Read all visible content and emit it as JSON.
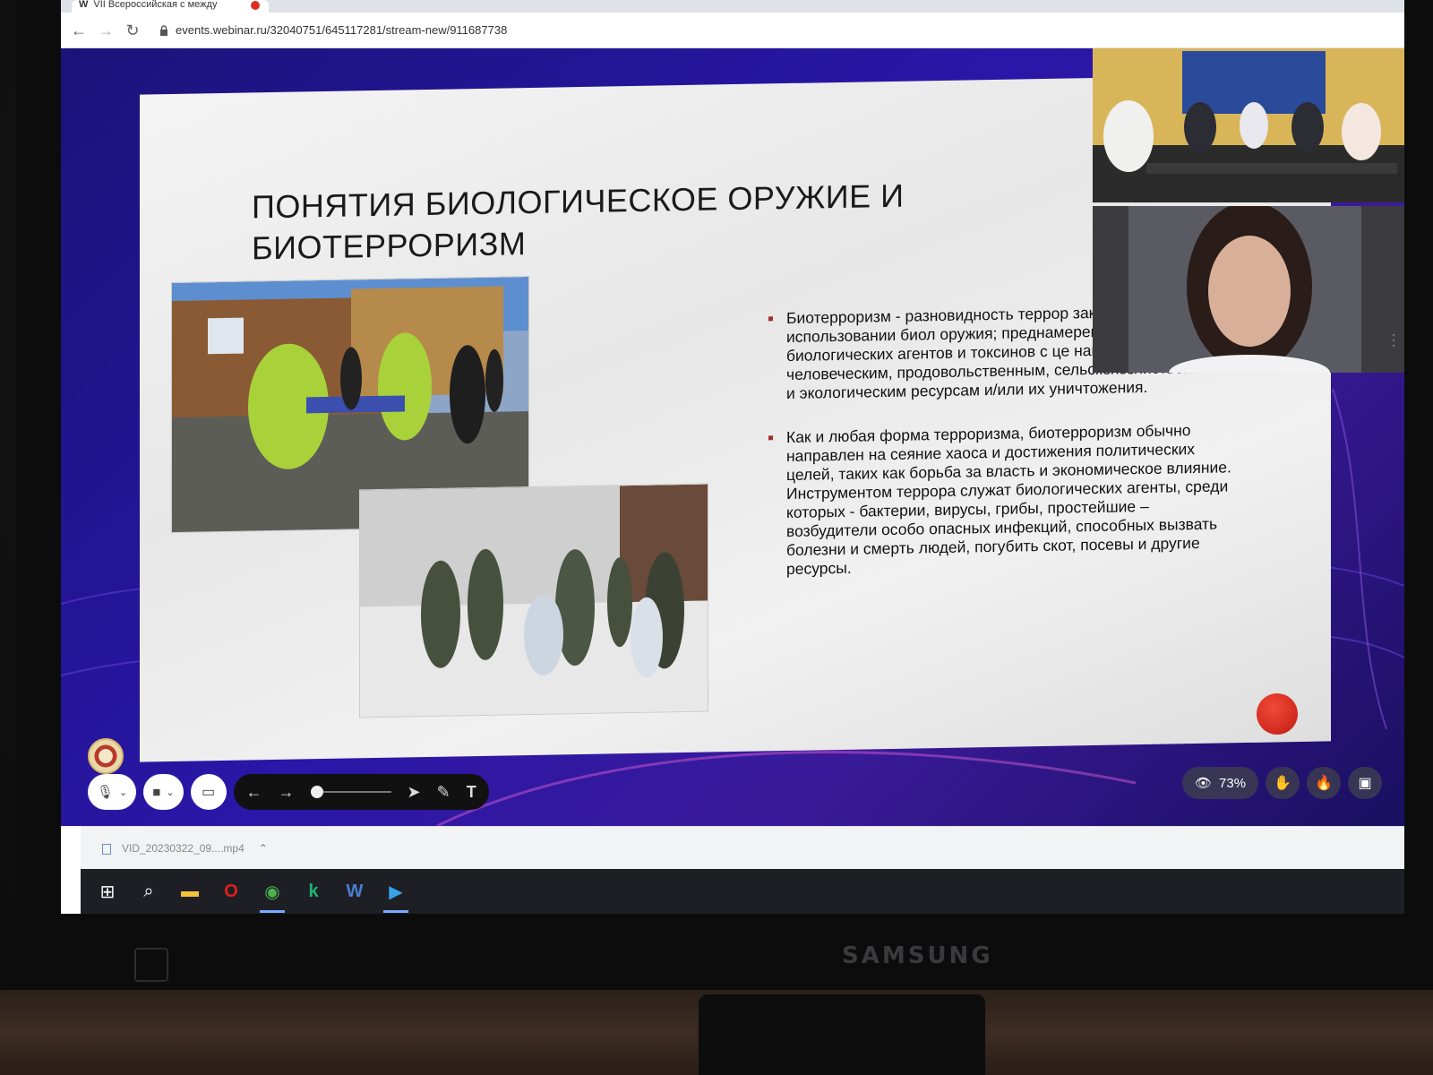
{
  "browser": {
    "tab_title": "VII Всероссийская с между",
    "tab_icon": "W",
    "url": "events.webinar.ru/32040751/645117281/stream-new/911687738"
  },
  "slide": {
    "title": "ПОНЯТИЯ БИОЛОГИЧЕСКОЕ ОРУЖИЕ И БИОТЕРРОРИЗМ",
    "bullets": [
      "Биотерроризм - разновидность террор заключающаяся в использовании биол оружия; преднамеренно скрытое испол биологических агентов и токсинов с це нанесения вреда человеческим, продовольственным, сельскохозяйственным и экологическим ресурсам и/или их уничтожения.",
      "Как и любая форма терроризма, биотерроризм обычно направлен на сеяние хаоса и достижения политических целей, таких как борьба за власть и экономическое влияние. Инструментом террора служат биологических агенты, среди которых - бактерии, вирусы, грибы, простейшие – возбудители особо опасных инфекций, способных вызвать болезни и смерть людей, погубить скот, посевы и другие ресурсы."
    ]
  },
  "controls": {
    "viewers_percent": "73%",
    "icons": [
      "microphone-icon",
      "camera-icon",
      "screen-share-icon",
      "arrow-left-icon",
      "arrow-right-icon",
      "pointer-icon",
      "pencil-icon",
      "text-tool-icon",
      "eye-icon",
      "raise-hand-icon",
      "fire-icon",
      "layout-icon"
    ]
  },
  "downloads": {
    "file_name": "VID_20230322_09....mp4"
  },
  "monitor": {
    "brand": "SAMSUNG"
  },
  "colors": {
    "stage_bg": "#2a16a8",
    "rec_button": "#d8271c",
    "bullet_marker": "#a0302a"
  }
}
